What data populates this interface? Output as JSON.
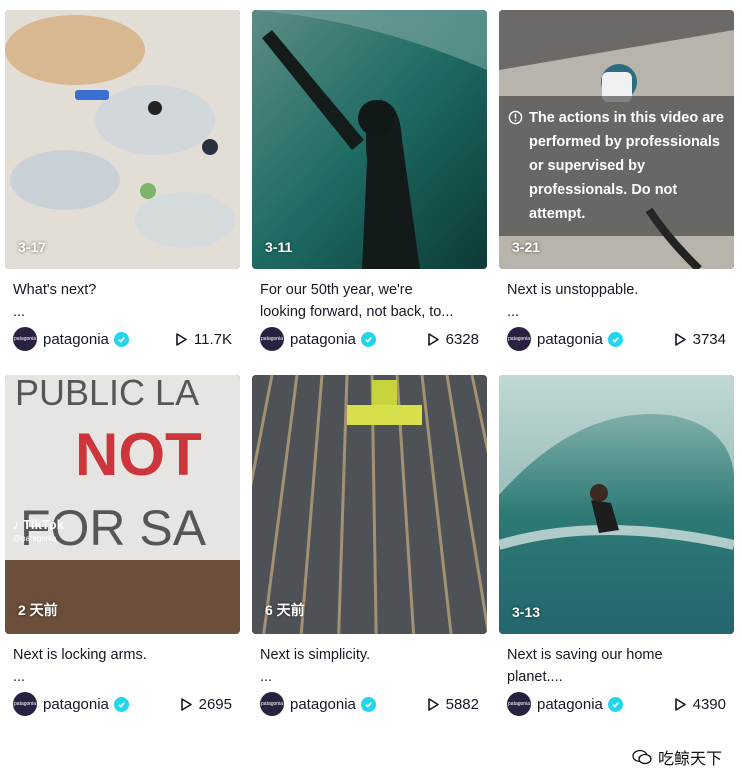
{
  "videos": [
    {
      "date": "3-17",
      "desc_line1": "What's next?",
      "desc_line2": "...",
      "username": "patagonia",
      "views": "11.7K"
    },
    {
      "date": "3-11",
      "desc_line1": "For our 50th year, we're",
      "desc_line2": "looking forward, not back, to...",
      "username": "patagonia",
      "views": "6328"
    },
    {
      "date": "3-21",
      "desc_line1": "Next is unstoppable.",
      "desc_line2": "...",
      "username": "patagonia",
      "views": "3734",
      "warning": "The actions in this video are performed by professionals or supervised by professionals. Do not attempt."
    },
    {
      "date": "2 天前",
      "desc_line1": "Next is locking arms.",
      "desc_line2": "...",
      "username": "patagonia",
      "views": "2695",
      "watermark_brand": "TikTok",
      "watermark_handle": "@patagonia"
    },
    {
      "date": "6 天前",
      "desc_line1": "Next is simplicity.",
      "desc_line2": "...",
      "username": "patagonia",
      "views": "5882"
    },
    {
      "date": "3-13",
      "desc_line1": "Next is saving our home",
      "desc_line2": "planet....",
      "username": "patagonia",
      "views": "4390"
    }
  ],
  "avatar_text": "patagonia",
  "icons": {
    "verified": "verified-check-icon",
    "play": "play-icon",
    "warning": "info-circle-icon",
    "music": "tiktok-note-icon",
    "wechat": "wechat-icon"
  },
  "colors": {
    "verified": "#20d5ec",
    "text": "#161823",
    "overlay": "#ffffff"
  },
  "wechat_watermark": "吃鲸天下"
}
